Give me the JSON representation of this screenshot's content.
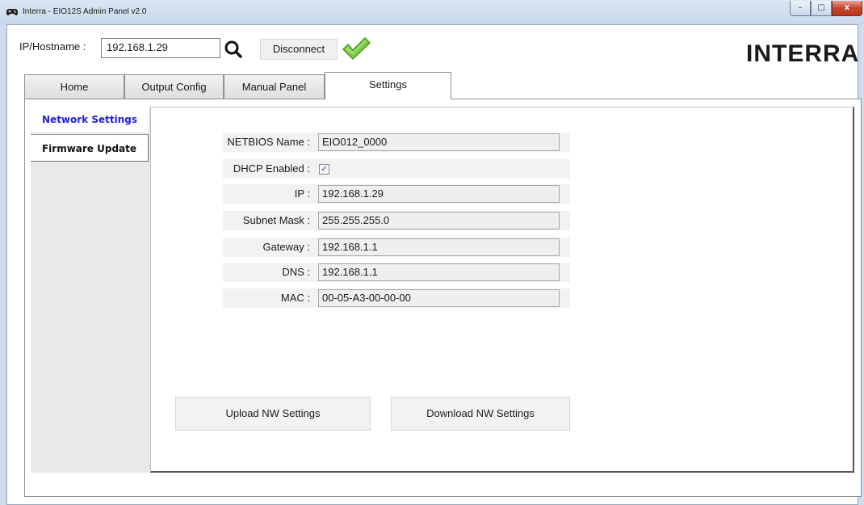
{
  "window": {
    "title": "Interra - EIO12S Admin Panel v2.0",
    "controls": {
      "minimize": "–",
      "maximize": "□",
      "close": "x"
    }
  },
  "toolbar": {
    "ip_label": "IP/Hostname :",
    "ip_value": "192.168.1.29",
    "search_icon": "search-icon",
    "disconnect_label": "Disconnect",
    "status_icon": "connected-check-icon",
    "status_color": "#7ac943"
  },
  "logo": {
    "text": "INTERRA"
  },
  "tabs": [
    {
      "label": "Home"
    },
    {
      "label": "Output Config"
    },
    {
      "label": "Manual Panel"
    },
    {
      "label": "Settings",
      "active": true
    }
  ],
  "sidebar": {
    "items": [
      {
        "label": "Network Settings",
        "active": true,
        "color": "#1f1fd6"
      },
      {
        "label": "Firmware Update"
      }
    ]
  },
  "network": {
    "fields": [
      {
        "label": "NETBIOS Name :",
        "value": "EIO012_0000"
      },
      {
        "label": "DHCP Enabled :",
        "checked": true
      },
      {
        "label": "IP :",
        "value": "192.168.1.29"
      },
      {
        "label": "Subnet Mask :",
        "value": "255.255.255.0"
      },
      {
        "label": "Gateway :",
        "value": "192.168.1.1"
      },
      {
        "label": "DNS :",
        "value": "192.168.1.1"
      },
      {
        "label": "MAC :",
        "value": "00-05-A3-00-00-00"
      }
    ],
    "upload_label": "Upload NW Settings",
    "download_label": "Download NW Settings"
  }
}
